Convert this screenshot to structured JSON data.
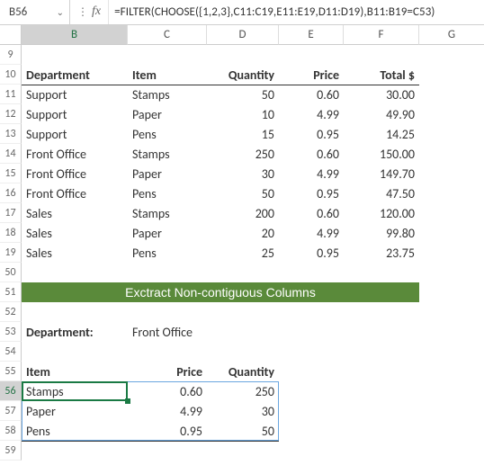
{
  "name_box": "B56",
  "formula": "=FILTER(CHOOSE({1,2,3},C11:C19,E11:E19,D11:D19),B11:B19=C53)",
  "columns": [
    "B",
    "C",
    "D",
    "E",
    "F",
    "G"
  ],
  "row_headers": [
    "9",
    "10",
    "11",
    "12",
    "13",
    "14",
    "15",
    "16",
    "17",
    "18",
    "19",
    "50",
    "51",
    "52",
    "53",
    "54",
    "55",
    "56",
    "57",
    "58",
    "59"
  ],
  "head": {
    "dept": "Department",
    "item": "Item",
    "qty": "Quantity",
    "price": "Price",
    "total": "Total  $"
  },
  "main_rows": [
    {
      "dept": "Support",
      "item": "Stamps",
      "qty": "50",
      "price": "0.60",
      "total": "30.00"
    },
    {
      "dept": "Support",
      "item": "Paper",
      "qty": "10",
      "price": "4.99",
      "total": "49.90"
    },
    {
      "dept": "Support",
      "item": "Pens",
      "qty": "15",
      "price": "0.95",
      "total": "14.25"
    },
    {
      "dept": "Front Office",
      "item": "Stamps",
      "qty": "250",
      "price": "0.60",
      "total": "150.00"
    },
    {
      "dept": "Front Office",
      "item": "Paper",
      "qty": "30",
      "price": "4.99",
      "total": "149.70"
    },
    {
      "dept": "Front Office",
      "item": "Pens",
      "qty": "50",
      "price": "0.95",
      "total": "47.50"
    },
    {
      "dept": "Sales",
      "item": "Stamps",
      "qty": "200",
      "price": "0.60",
      "total": "120.00"
    },
    {
      "dept": "Sales",
      "item": "Paper",
      "qty": "20",
      "price": "4.99",
      "total": "99.80"
    },
    {
      "dept": "Sales",
      "item": "Pens",
      "qty": "25",
      "price": "0.95",
      "total": "23.75"
    }
  ],
  "banner": "Exctract Non-contiguous Columns",
  "filter_label": "Department:",
  "filter_value": "Front Office",
  "out_head": {
    "item": "Item",
    "price": "Price",
    "qty": "Quantity"
  },
  "out_rows": [
    {
      "item": "Stamps",
      "price": "0.60",
      "qty": "250"
    },
    {
      "item": "Paper",
      "price": "4.99",
      "qty": "30"
    },
    {
      "item": "Pens",
      "price": "0.95",
      "qty": "50"
    }
  ],
  "chart_data": {
    "type": "table",
    "title": "Filter CHOOSE non-contiguous columns",
    "series": [
      {
        "name": "Support",
        "values": {
          "Stamps": 50,
          "Paper": 10,
          "Pens": 15
        }
      },
      {
        "name": "Front Office",
        "values": {
          "Stamps": 250,
          "Paper": 30,
          "Pens": 50
        }
      },
      {
        "name": "Sales",
        "values": {
          "Stamps": 200,
          "Paper": 20,
          "Pens": 25
        }
      }
    ],
    "prices": {
      "Stamps": 0.6,
      "Paper": 4.99,
      "Pens": 0.95
    }
  }
}
